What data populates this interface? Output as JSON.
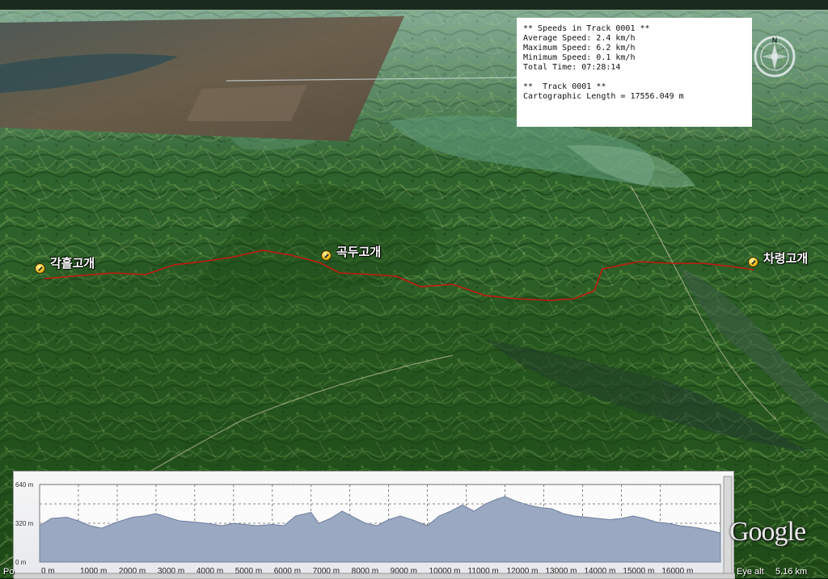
{
  "info_box": {
    "lines": [
      "** Speeds in Track 0001 **",
      "Average Speed: 2.4 km/h",
      "Maximum Speed: 6.2 km/h",
      "Minimum Speed: 0.1 km/h",
      "Total Time: 07:28:14",
      "",
      "**  Track 0001 **",
      "Cartographic Length = 17556.049 m"
    ]
  },
  "compass": {
    "north_label": "N"
  },
  "waypoints": [
    {
      "name": "각흘고개",
      "icon": "waypoint-pin-icon"
    },
    {
      "name": "곡두고개",
      "icon": "waypoint-pin-icon"
    },
    {
      "name": "차령고개",
      "icon": "waypoint-pin-icon"
    }
  ],
  "chart_data": {
    "type": "area",
    "y_ticks": [
      "640 m",
      "320 m",
      "0 m"
    ],
    "ylim": [
      0,
      640
    ],
    "x_ticks": [
      "0 m",
      "1000 m",
      "2000 m",
      "3000 m",
      "4000 m",
      "5000 m",
      "6000 m",
      "7000 m",
      "8000 m",
      "9000 m",
      "10000 m",
      "11000 m",
      "12000 m",
      "13000 m",
      "14000 m",
      "15000 m",
      "16000 m"
    ],
    "xlim": [
      0,
      17556
    ],
    "grid": true,
    "x": [
      0,
      300,
      700,
      1000,
      1300,
      1600,
      2000,
      2400,
      2700,
      3000,
      3300,
      3600,
      4000,
      4300,
      4700,
      5000,
      5300,
      5600,
      6000,
      6300,
      6600,
      7000,
      7200,
      7500,
      7800,
      8100,
      8400,
      8700,
      9000,
      9300,
      9600,
      10000,
      10300,
      10600,
      10900,
      11200,
      11500,
      11800,
      12000,
      12300,
      12600,
      12900,
      13200,
      13500,
      13800,
      14100,
      14400,
      14700,
      15000,
      15300,
      15600,
      15900,
      16200,
      16500,
      16800,
      17000,
      17300,
      17556
    ],
    "elevation": [
      300,
      360,
      370,
      340,
      300,
      280,
      330,
      370,
      380,
      400,
      370,
      340,
      330,
      320,
      300,
      320,
      310,
      300,
      310,
      300,
      380,
      410,
      320,
      360,
      420,
      370,
      320,
      300,
      350,
      380,
      350,
      300,
      380,
      420,
      470,
      420,
      480,
      520,
      540,
      500,
      470,
      450,
      440,
      400,
      380,
      370,
      360,
      350,
      360,
      380,
      360,
      330,
      320,
      300,
      290,
      280,
      260,
      240
    ]
  },
  "status_bar": {
    "left_text": "Po",
    "eye_alt_label": "Eye alt",
    "eye_alt_value": "5.16 km"
  },
  "logo_text": "Google"
}
